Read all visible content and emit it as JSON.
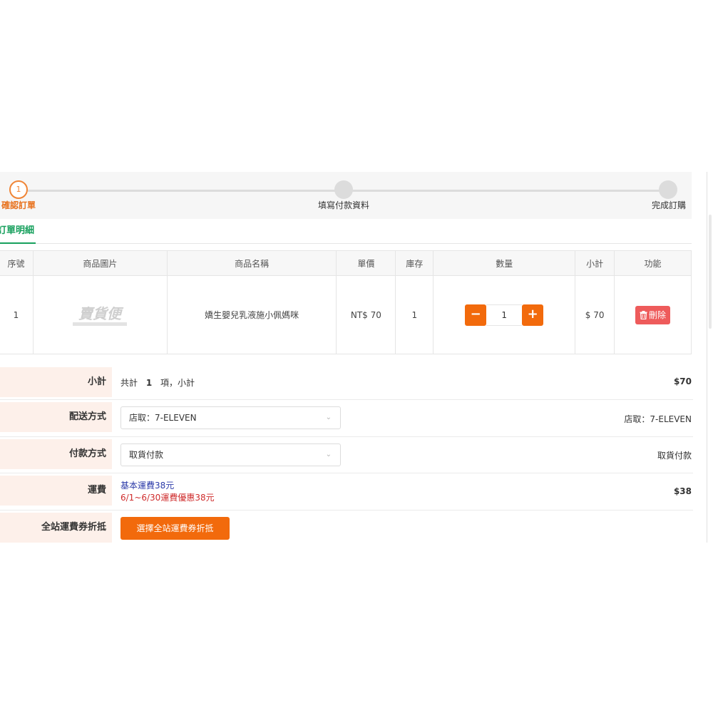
{
  "stepper": {
    "steps": [
      {
        "number": "1",
        "label": "確認訂單"
      },
      {
        "label": "填寫付款資料"
      },
      {
        "label": "完成訂購"
      }
    ]
  },
  "tabs": {
    "active_label": "訂單明細"
  },
  "table": {
    "headers": [
      "序號",
      "商品圖片",
      "商品名稱",
      "單價",
      "庫存",
      "數量",
      "小計",
      "功能"
    ],
    "rows": [
      {
        "index": "1",
        "image_caption": "賣貨便",
        "name": "嬌生嬰兒乳液施小佩媽咪",
        "price": "NT$ 70",
        "stock": "1",
        "qty": "1",
        "qty_minus": "−",
        "qty_plus": "+",
        "subtotal": "$ 70",
        "delete_label": "刪除"
      }
    ]
  },
  "summary": {
    "subtotal": {
      "label": "小計",
      "prefix": "共計",
      "count": "1",
      "suffix": "項，小計",
      "amount": "$70"
    },
    "shipping_method": {
      "label": "配送方式",
      "selected": "店取：7-ELEVEN",
      "display": "店取：7-ELEVEN"
    },
    "payment_method": {
      "label": "付款方式",
      "selected": "取貨付款",
      "display": "取貨付款"
    },
    "shipping_fee": {
      "label": "運費",
      "base": "基本運費38元",
      "promo": "6/1~6/30運費優惠38元",
      "amount": "$38"
    },
    "coupon": {
      "label": "全站運費券折抵",
      "button": "選擇全站運費券折抵"
    }
  },
  "colors": {
    "accent_orange": "#f26a0c",
    "step_active": "#e8731f",
    "tab_green": "#17a05d",
    "delete_red": "#ee5b5b",
    "label_bg": "#fdf0ea"
  },
  "icons": {
    "minus": "minus-icon",
    "plus": "plus-icon",
    "trash": "trash-icon",
    "chevron": "chevron-down-icon"
  }
}
